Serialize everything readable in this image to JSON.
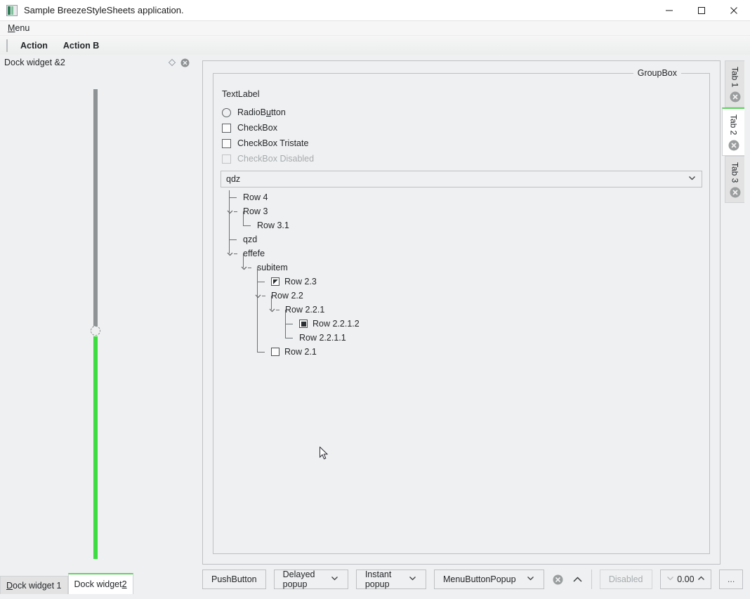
{
  "window": {
    "title": "Sample BreezeStyleSheets application.",
    "icon": "app-icon",
    "minimize": "─",
    "maximize": "□",
    "close": "✕"
  },
  "menubar": {
    "items": [
      {
        "label": "Menu",
        "accel": "M"
      }
    ]
  },
  "toolbar": {
    "actions": [
      "Action",
      "Action B"
    ]
  },
  "dock": {
    "title": "Dock widget &2",
    "float_icon": "float-icon",
    "close_icon": "close-icon",
    "slider": {
      "orientation": "vertical",
      "handle_position_pct": 49
    },
    "tabs": [
      {
        "label": "Dock widget 1",
        "accel": "D",
        "selected": false
      },
      {
        "label": "Dock widget 2",
        "accel": "2",
        "selected": true
      }
    ]
  },
  "central": {
    "groupbox": {
      "title": "GroupBox"
    },
    "text_label": "TextLabel",
    "controls": [
      {
        "type": "radio",
        "label": "RadioButton",
        "accel": "u",
        "checked": false,
        "enabled": true
      },
      {
        "type": "checkbox",
        "label": "CheckBox",
        "state": "unchecked",
        "enabled": true
      },
      {
        "type": "checkbox",
        "label": "CheckBox Tristate",
        "state": "unchecked",
        "enabled": true
      },
      {
        "type": "checkbox",
        "label": "CheckBox Disabled",
        "state": "unchecked",
        "enabled": false
      }
    ],
    "combobox": {
      "value": "qdz",
      "arrow": "chevron-down-icon"
    },
    "tree": {
      "rows": [
        {
          "label": "Row 4",
          "depth": 1,
          "expander": "none",
          "checkbox": "none",
          "last": false
        },
        {
          "label": "Row 3",
          "depth": 1,
          "expander": "expanded",
          "checkbox": "none",
          "last": false
        },
        {
          "label": "Row 3.1",
          "depth": 2,
          "expander": "none",
          "checkbox": "none",
          "last": true
        },
        {
          "label": "qzd",
          "depth": 1,
          "expander": "none",
          "checkbox": "none",
          "last": false
        },
        {
          "label": "effefe",
          "depth": 1,
          "expander": "expanded",
          "checkbox": "none",
          "last": true
        },
        {
          "label": "subitem",
          "depth": 2,
          "expander": "expanded",
          "checkbox": "none",
          "last": false
        },
        {
          "label": "Row 2.3",
          "depth": 3,
          "expander": "none",
          "checkbox": "partial",
          "last": false
        },
        {
          "label": "Row 2.2",
          "depth": 3,
          "expander": "expanded",
          "checkbox": "none",
          "last": false
        },
        {
          "label": "Row 2.2.1",
          "depth": 4,
          "expander": "expanded",
          "checkbox": "none",
          "last": false
        },
        {
          "label": "Row 2.2.1.2",
          "depth": 5,
          "expander": "none",
          "checkbox": "checked",
          "last": false
        },
        {
          "label": "Row 2.2.1.1",
          "depth": 5,
          "expander": "none",
          "checkbox": "none",
          "last": true
        },
        {
          "label": "Row 2.1",
          "depth": 3,
          "expander": "none",
          "checkbox": "unchecked",
          "last": true
        }
      ]
    },
    "vtabs": [
      {
        "label": "Tab 1",
        "selected": false,
        "close_icon": "close-circle-icon"
      },
      {
        "label": "Tab 2",
        "selected": true,
        "close_icon": "close-circle-icon"
      },
      {
        "label": "Tab 3",
        "selected": false,
        "close_icon": "close-circle-icon"
      }
    ],
    "bottom_bar": {
      "push_button": "PushButton",
      "delayed_popup": "Delayed popup",
      "instant_popup": "Instant popup",
      "menu_button_popup": "MenuButtonPopup",
      "close_tool": "close-circle-icon",
      "up_tool": "chevron-up-icon",
      "disabled_button": "Disabled",
      "spinbox": {
        "value": "0.00",
        "down": "chevron-down-icon",
        "up": "chevron-up-icon"
      },
      "dots_button": "..."
    }
  },
  "colors": {
    "background": "#eff0f1",
    "border": "#bdc0c3",
    "accent_green": "#3ddc40",
    "tab_accent": "#5fd35f",
    "text": "#232629",
    "disabled_text": "#a7abae"
  }
}
